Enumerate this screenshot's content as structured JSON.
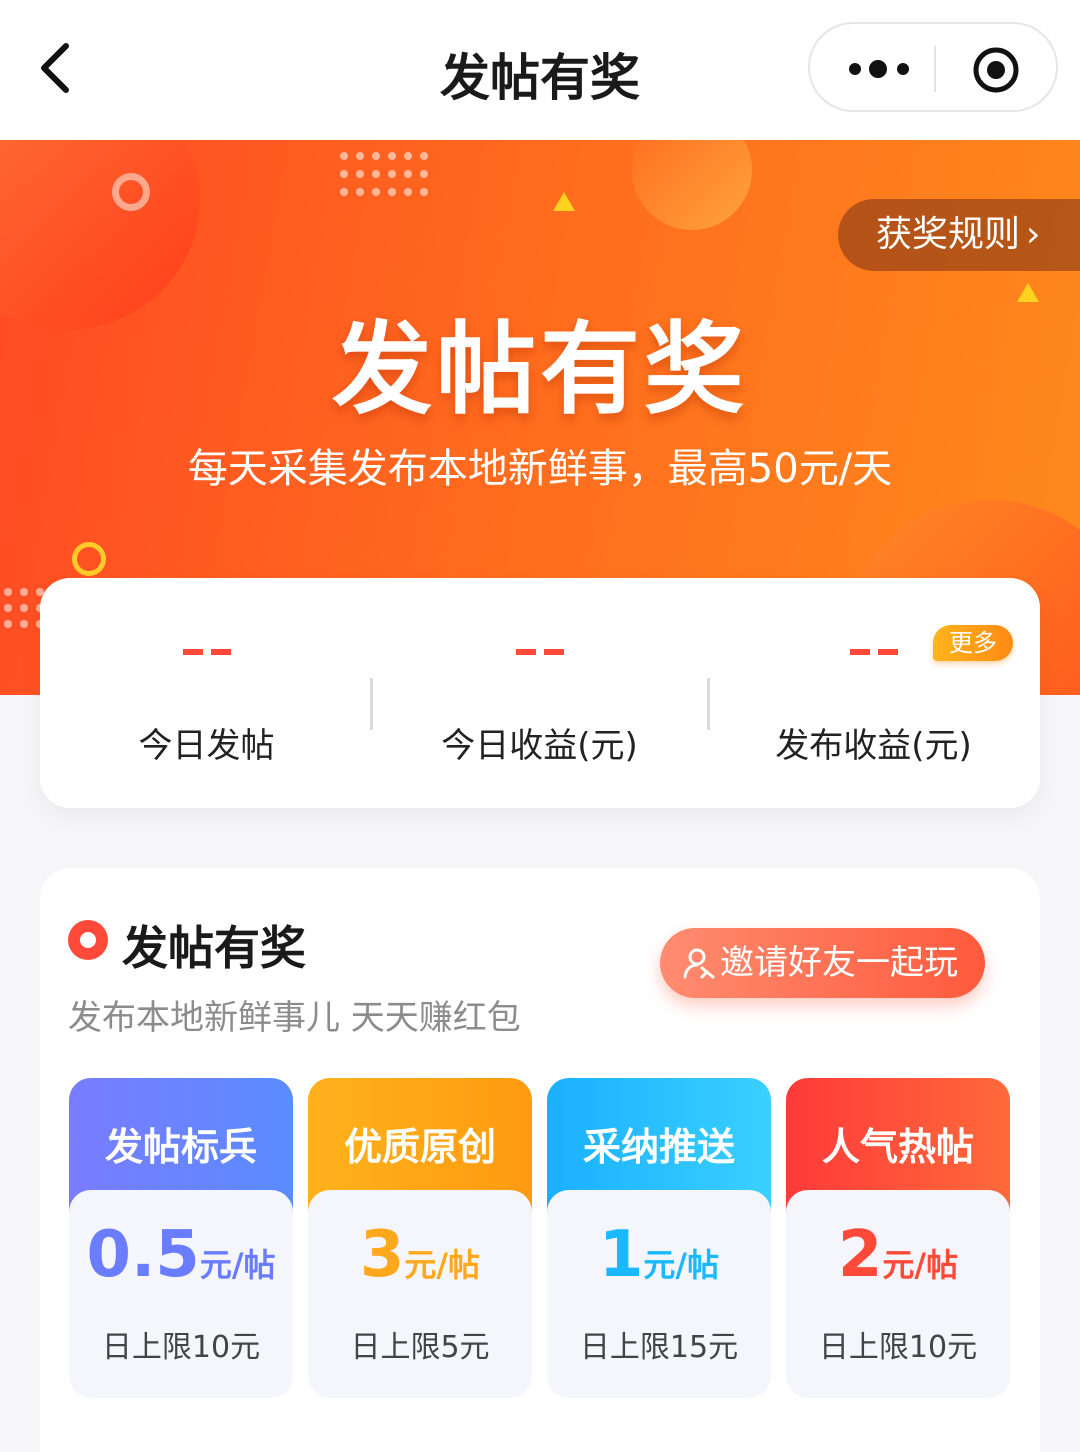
{
  "nav": {
    "title": "发帖有奖"
  },
  "banner": {
    "rules_label": "获奖规则",
    "title": "发帖有奖",
    "subtitle": "每天采集发布本地新鲜事，最高50元/天"
  },
  "stats": {
    "items": [
      {
        "value": "--",
        "label": "今日发帖"
      },
      {
        "value": "--",
        "label": "今日收益(元)"
      },
      {
        "value": "--",
        "label": "发布收益(元)"
      }
    ],
    "more_badge": "更多"
  },
  "section": {
    "title": "发帖有奖",
    "subtitle": "发布本地新鲜事儿 天天赚红包",
    "invite_label": "邀请好友一起玩",
    "rewards": [
      {
        "name": "发帖标兵",
        "amount": "0.5",
        "unit": "元/帖",
        "limit": "日上限10元",
        "color": "#6a7cff"
      },
      {
        "name": "优质原创",
        "amount": "3",
        "unit": "元/帖",
        "limit": "日上限5元",
        "color": "#ffa81c"
      },
      {
        "name": "采纳推送",
        "amount": "1",
        "unit": "元/帖",
        "limit": "日上限15元",
        "color": "#1ab8ff"
      },
      {
        "name": "人气热帖",
        "amount": "2",
        "unit": "元/帖",
        "limit": "日上限10元",
        "color": "#ff4a3a"
      }
    ]
  }
}
